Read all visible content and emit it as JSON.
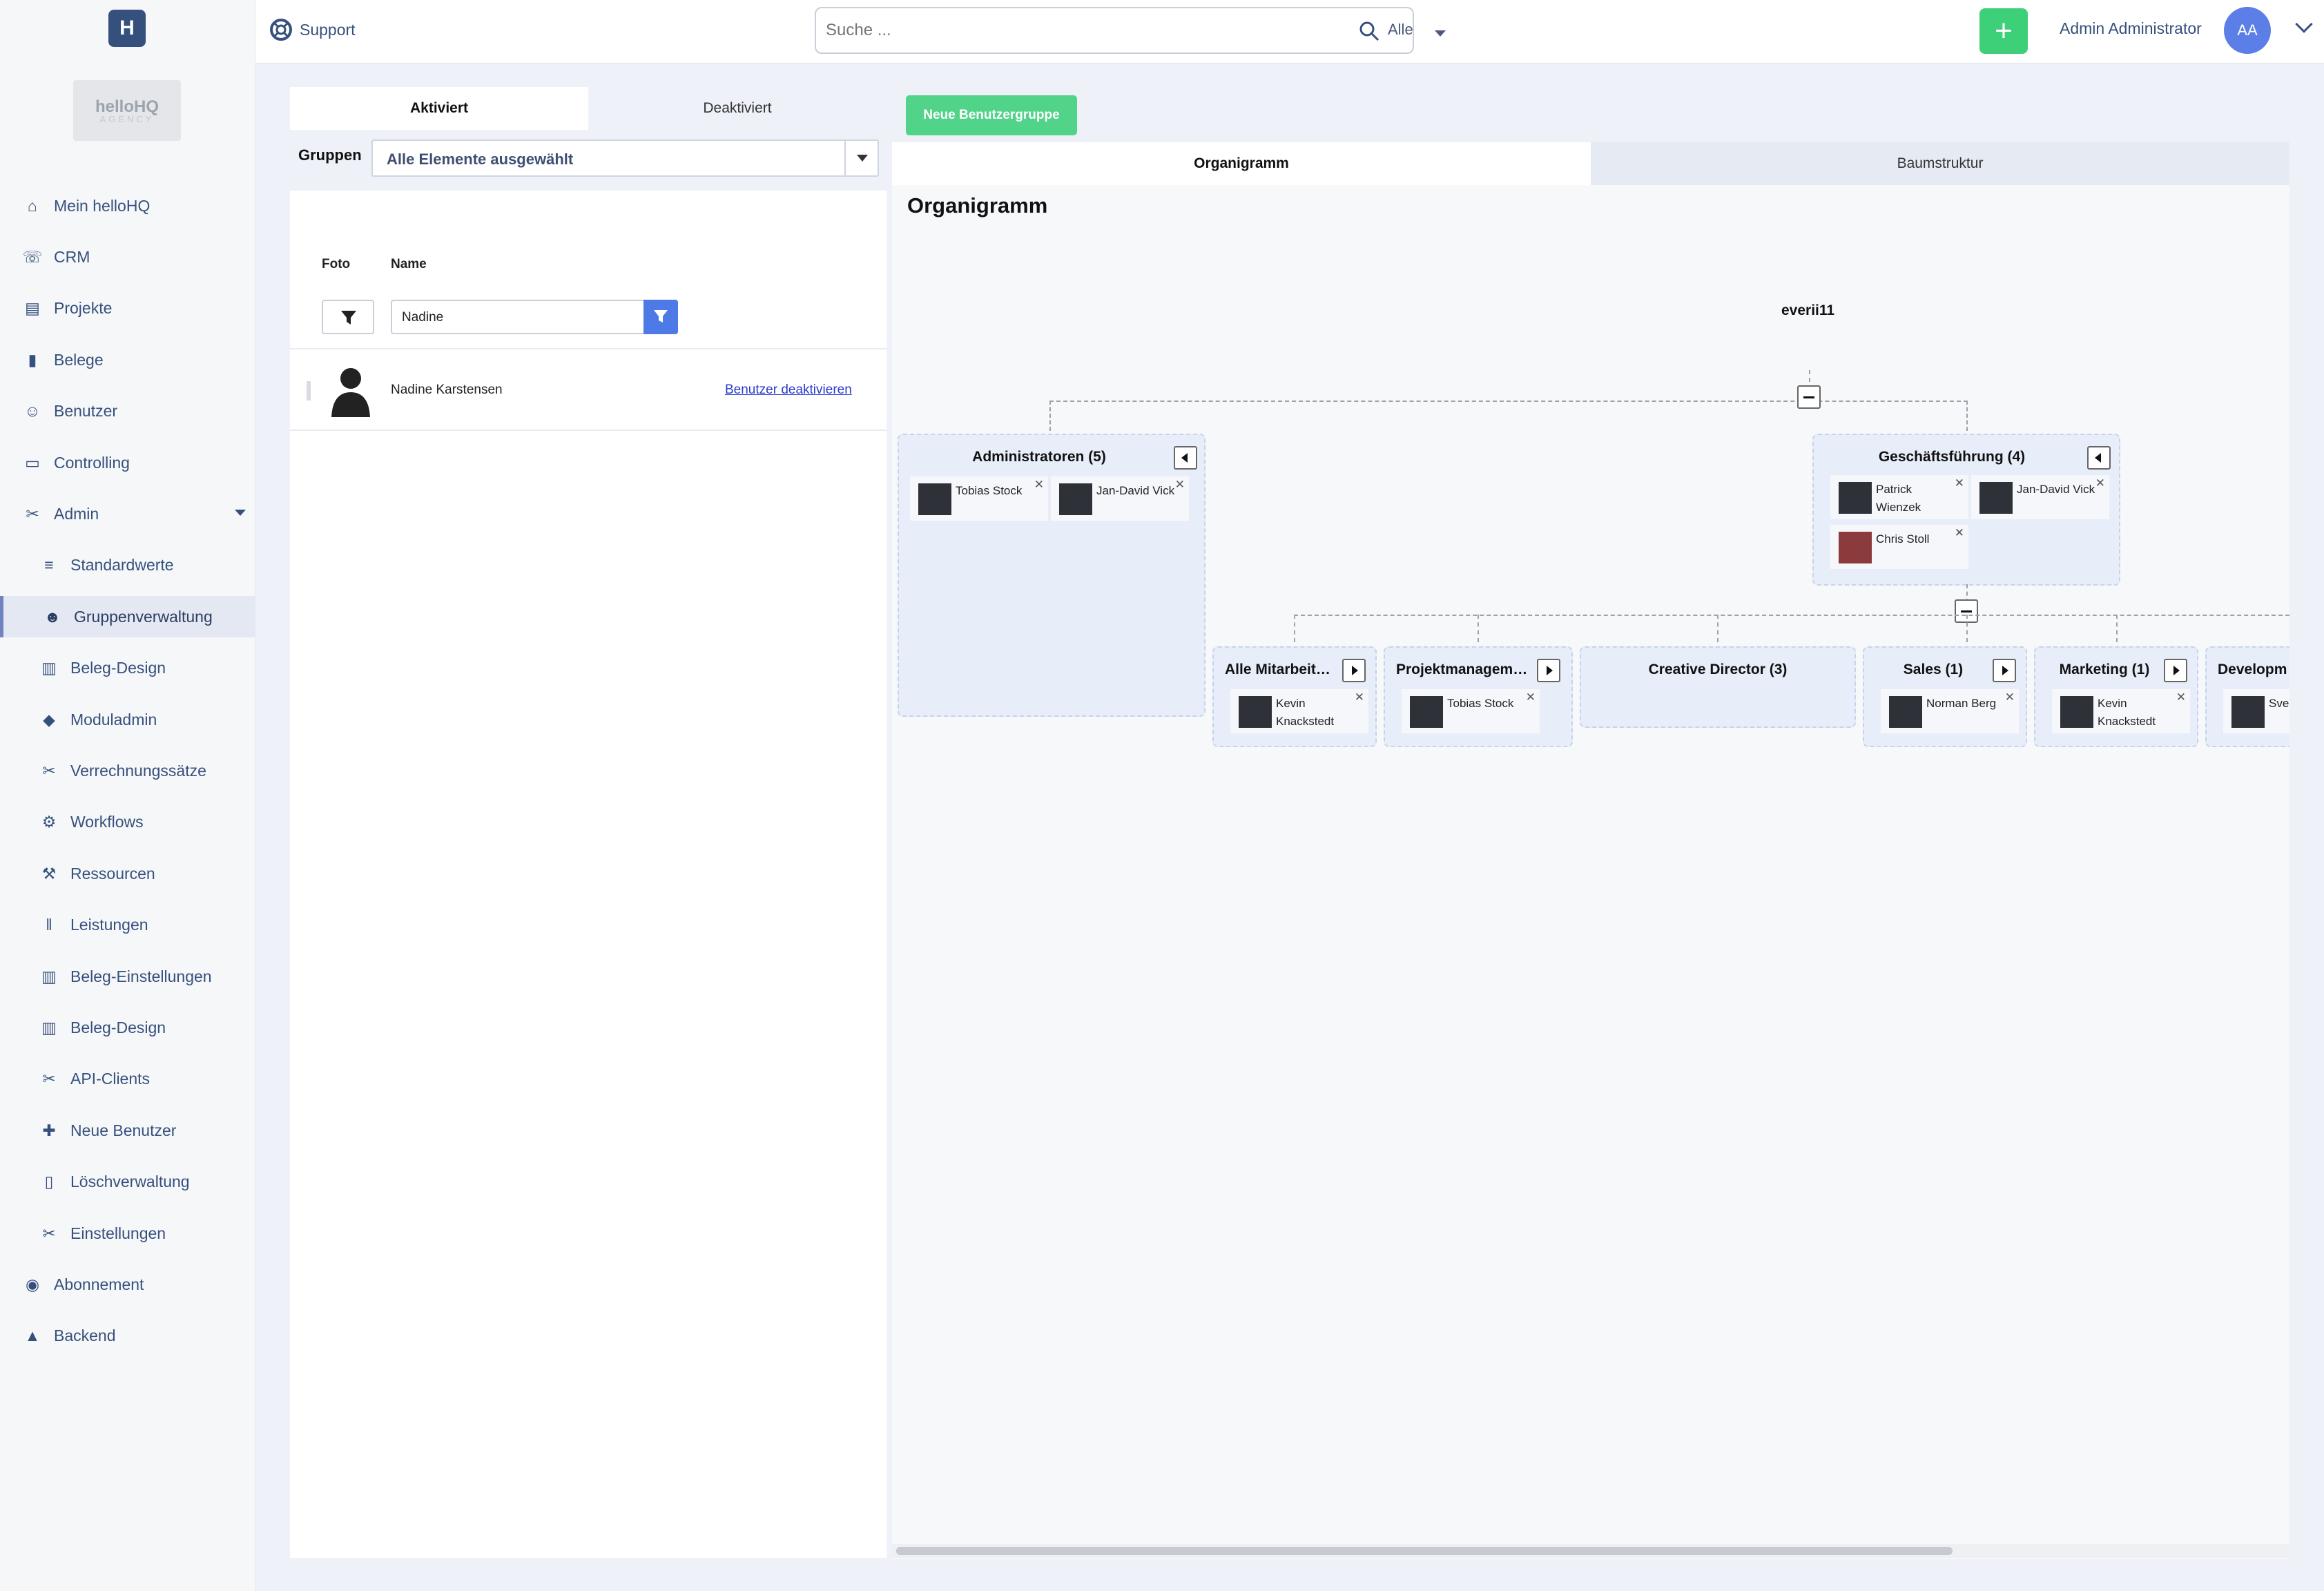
{
  "topbar": {
    "support": "Support",
    "search_placeholder": "Suche ...",
    "search_scope": "Alle",
    "user_name": "Admin Administrator",
    "avatar_initials": "AA",
    "add_label": "+"
  },
  "brand": {
    "logo": "H",
    "name": "helloHQ",
    "sub": "AGENCY"
  },
  "sidebar": {
    "items": [
      {
        "label": "Mein helloHQ",
        "icon": "home-icon"
      },
      {
        "label": "CRM",
        "icon": "crm-icon"
      },
      {
        "label": "Projekte",
        "icon": "projects-icon"
      },
      {
        "label": "Belege",
        "icon": "document-icon"
      },
      {
        "label": "Benutzer",
        "icon": "users-icon"
      },
      {
        "label": "Controlling",
        "icon": "monitor-icon"
      },
      {
        "label": "Admin",
        "icon": "tools-icon"
      },
      {
        "label": "Standardwerte",
        "icon": "list-icon"
      },
      {
        "label": "Gruppenverwaltung",
        "icon": "group-icon",
        "active": true
      },
      {
        "label": "Beleg-Design",
        "icon": "design-icon"
      },
      {
        "label": "Moduladmin",
        "icon": "modules-icon"
      },
      {
        "label": "Verrechnungssätze",
        "icon": "tools-icon"
      },
      {
        "label": "Workflows",
        "icon": "gears-icon"
      },
      {
        "label": "Ressourcen",
        "icon": "resources-icon"
      },
      {
        "label": "Leistungen",
        "icon": "barcode-icon"
      },
      {
        "label": "Beleg-Einstellungen",
        "icon": "design-icon"
      },
      {
        "label": "Beleg-Design",
        "icon": "design-icon"
      },
      {
        "label": "API-Clients",
        "icon": "tools-icon"
      },
      {
        "label": "Neue Benutzer",
        "icon": "new-user-icon"
      },
      {
        "label": "Löschverwaltung",
        "icon": "trash-icon"
      },
      {
        "label": "Einstellungen",
        "icon": "tools-icon"
      },
      {
        "label": "Abonnement",
        "icon": "circle-icon"
      },
      {
        "label": "Backend",
        "icon": "backend-icon"
      }
    ]
  },
  "left": {
    "tab_active": "Aktiviert",
    "tab_inactive": "Deaktiviert",
    "groups_label": "Gruppen",
    "groups_value": "Alle Elemente ausgewählt",
    "col_photo": "Foto",
    "col_name": "Name",
    "filter_value": "Nadine",
    "rows": [
      {
        "name": "Nadine Karstensen",
        "action": "Benutzer deaktivieren"
      }
    ]
  },
  "right": {
    "new_group": "Neue Benutzergruppe",
    "tab_active": "Organigramm",
    "tab_inactive": "Baumstruktur",
    "title": "Organigramm",
    "root": "everii11",
    "nodes": [
      {
        "title": "Administratoren (5)",
        "members": [
          "Tobias Stock",
          "Jan-David Vick"
        ]
      },
      {
        "title": "Geschäftsführung (4)",
        "members": [
          "Patrick Wienzek",
          "Jan-David Vick",
          "Chris Stoll"
        ]
      },
      {
        "title": "Alle Mitarbeit…",
        "members": [
          "Kevin Knackstedt"
        ]
      },
      {
        "title": "Projektmanagem…",
        "members": [
          "Tobias Stock"
        ]
      },
      {
        "title": "Creative Director (3)",
        "members": []
      },
      {
        "title": "Sales (1)",
        "members": [
          "Norman Berg"
        ]
      },
      {
        "title": "Marketing (1)",
        "members": [
          "Kevin Knackstedt"
        ]
      },
      {
        "title": "Developm",
        "members": [
          "Sven Born"
        ]
      }
    ]
  }
}
